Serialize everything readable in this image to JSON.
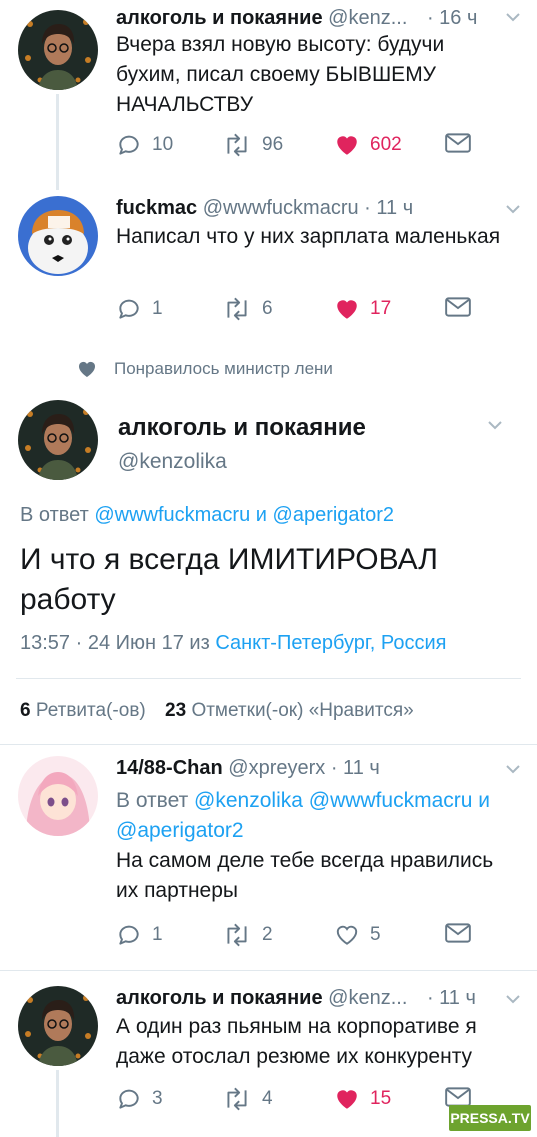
{
  "tweet1": {
    "name": "алкоголь и покаяние",
    "handle": "@kenz...",
    "time": "· 16 ч",
    "text_lines": [
      "Вчера взял новую высоту: будучи",
      "бухим, писал своему БЫВШЕМУ",
      "НАЧАЛЬСТВУ"
    ],
    "replies": "10",
    "retweets": "96",
    "likes": "602"
  },
  "tweet2": {
    "name": "fuckmac",
    "handle": "@wwwfuckmacru",
    "time": "· 11 ч",
    "text": "Написал что у них зарплата маленькая",
    "replies": "1",
    "retweets": "6",
    "likes": "17"
  },
  "liked_by": "Понравилось министр лени",
  "main": {
    "name": "алкоголь и покаяние",
    "handle": "@kenzolika",
    "reply_prefix": "В ответ",
    "reply_user1": "@wwwfuckmacru",
    "reply_and": "и",
    "reply_user2": "@aperigator2",
    "text_lines": [
      "И что я всегда ИМИТИРОВАЛ",
      "работу"
    ],
    "time": "13:57 · 24 Июн 17",
    "from": "из",
    "location": "Санкт-Петербург, Россия",
    "retweet_count": "6",
    "retweet_label": "Ретвита(-ов)",
    "like_count": "23",
    "like_label": "Отметки(-ок) «Нравится»"
  },
  "tweet3": {
    "name": "14/88-Chan",
    "handle": "@xpreyerx",
    "time": "· 11 ч",
    "reply_prefix": "В ответ",
    "reply_users_line1": "@kenzolika @wwwfuckmacru и",
    "reply_users_line2": "@aperigator2",
    "text_lines": [
      "На самом деле тебе всегда нравились",
      "их партнеры"
    ],
    "replies": "1",
    "retweets": "2",
    "likes": "5"
  },
  "tweet4": {
    "name": "алкоголь и покаяние",
    "handle": "@kenz...",
    "time": "· 11 ч",
    "text_lines": [
      "А один раз пьяным на корпоративе я",
      "даже отослал резюме их конкуренту"
    ],
    "replies": "3",
    "retweets": "4",
    "likes": "15"
  },
  "watermark": "PRESSA.TV",
  "colors": {
    "link": "#1da1f2",
    "like": "#e0245e",
    "muted": "#657786",
    "divider": "#e1e8ed"
  },
  "icons": [
    "reply-icon",
    "retweet-icon",
    "heart-icon",
    "message-icon",
    "chevron-down-icon"
  ]
}
